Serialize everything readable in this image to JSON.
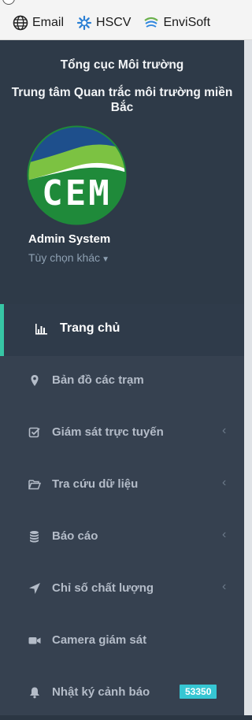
{
  "bookmarks": [
    {
      "label": "Email",
      "icon": "globe-icon"
    },
    {
      "label": "HSCV",
      "icon": "hscv-logo-icon"
    },
    {
      "label": "EnviSoft",
      "icon": "envisoft-logo-icon"
    }
  ],
  "sidebar": {
    "org_line1": "Tổng cục Môi trường",
    "org_line2": "Trung tâm Quan trắc môi trường miền Bắc",
    "logo_text": "CEM",
    "user_name": "Admin System",
    "options_label": "Tùy chọn khác",
    "menu": [
      {
        "label": "Trang chủ",
        "icon": "bar-chart-icon",
        "active": true
      },
      {
        "label": "Bản đồ các trạm",
        "icon": "map-marker-icon"
      },
      {
        "label": "Giám sát trực tuyến",
        "icon": "check-square-icon",
        "arrow": "‹"
      },
      {
        "label": "Tra cứu dữ liệu",
        "icon": "folder-open-icon",
        "arrow": "‹"
      },
      {
        "label": "Báo cáo",
        "icon": "database-icon",
        "arrow": "‹"
      },
      {
        "label": "Chỉ số chất lượng",
        "icon": "location-arrow-icon",
        "arrow": "‹"
      },
      {
        "label": "Camera giám sát",
        "icon": "video-camera-icon"
      },
      {
        "label": "Nhật ký cảnh báo",
        "icon": "bell-icon",
        "badge": "53350"
      }
    ]
  },
  "colors": {
    "sidebar_bg": "#364150",
    "active_accent": "#37c6a5",
    "badge_bg": "#36c6d3",
    "logo_green": "#1f8a3a",
    "logo_blue": "#1e4f8c"
  }
}
